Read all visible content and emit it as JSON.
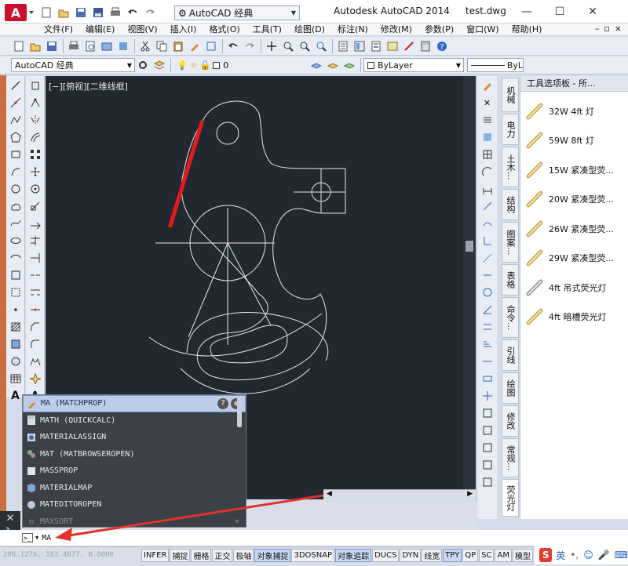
{
  "app": {
    "title": "Autodesk AutoCAD 2014",
    "file": "test.dwg",
    "workspace": "AutoCAD 经典"
  },
  "menu": [
    "文件(F)",
    "编辑(E)",
    "视图(V)",
    "插入(I)",
    "格式(O)",
    "工具(T)",
    "绘图(D)",
    "标注(N)",
    "修改(M)",
    "参数(P)",
    "窗口(W)",
    "帮助(H)"
  ],
  "toolbar2": {
    "workspace": "AutoCAD 经典",
    "layer": "0",
    "color": "ByLayer",
    "linetype": "ByL"
  },
  "viewport": {
    "label": "[−][俯视][二维线框]"
  },
  "palette": {
    "title": "工具选项板 - 所...",
    "items": [
      "32W 4ft 灯",
      "59W 8ft 灯",
      "15W 紧凑型荧...",
      "20W 紧凑型荧...",
      "26W 紧凑型荧...",
      "29W 紧凑型荧...",
      "4ft 吊式荧光灯",
      "4ft 暗槽荧光灯"
    ],
    "tabs": [
      "机械",
      "电力",
      "土木...",
      "结构",
      "图案...",
      "表格",
      "命令...",
      "引线",
      "绘图",
      "修改",
      "常规...",
      "荧光灯"
    ]
  },
  "autocomplete": {
    "items": [
      "MA (MATCHPROP)",
      "MATH (QUICKCALC)",
      "MATERIALASSIGN",
      "MAT (MATBROWSEROPEN)",
      "MASSPROP",
      "MATERIALMAP",
      "MATEDITOROPEN",
      "MAXSORT"
    ]
  },
  "command": {
    "input": "MA"
  },
  "status": {
    "coords": "206.1276, 163.4677, 0.0000",
    "buttons": [
      "INFER",
      "捕捉",
      "栅格",
      "正交",
      "极轴",
      "对象捕捉",
      "3DOSNAP",
      "对象追踪",
      "DUCS",
      "DYN",
      "线宽",
      "TPY",
      "QP",
      "SC",
      "AM",
      "模型"
    ],
    "active": [
      "对象捕捉",
      "对象追踪",
      "TPY"
    ]
  },
  "tray": {
    "ime": "英"
  },
  "colors": {
    "canvas": "#212830",
    "highlight_line": "#e31b1b",
    "annotation_arrow": "#e0332a"
  }
}
